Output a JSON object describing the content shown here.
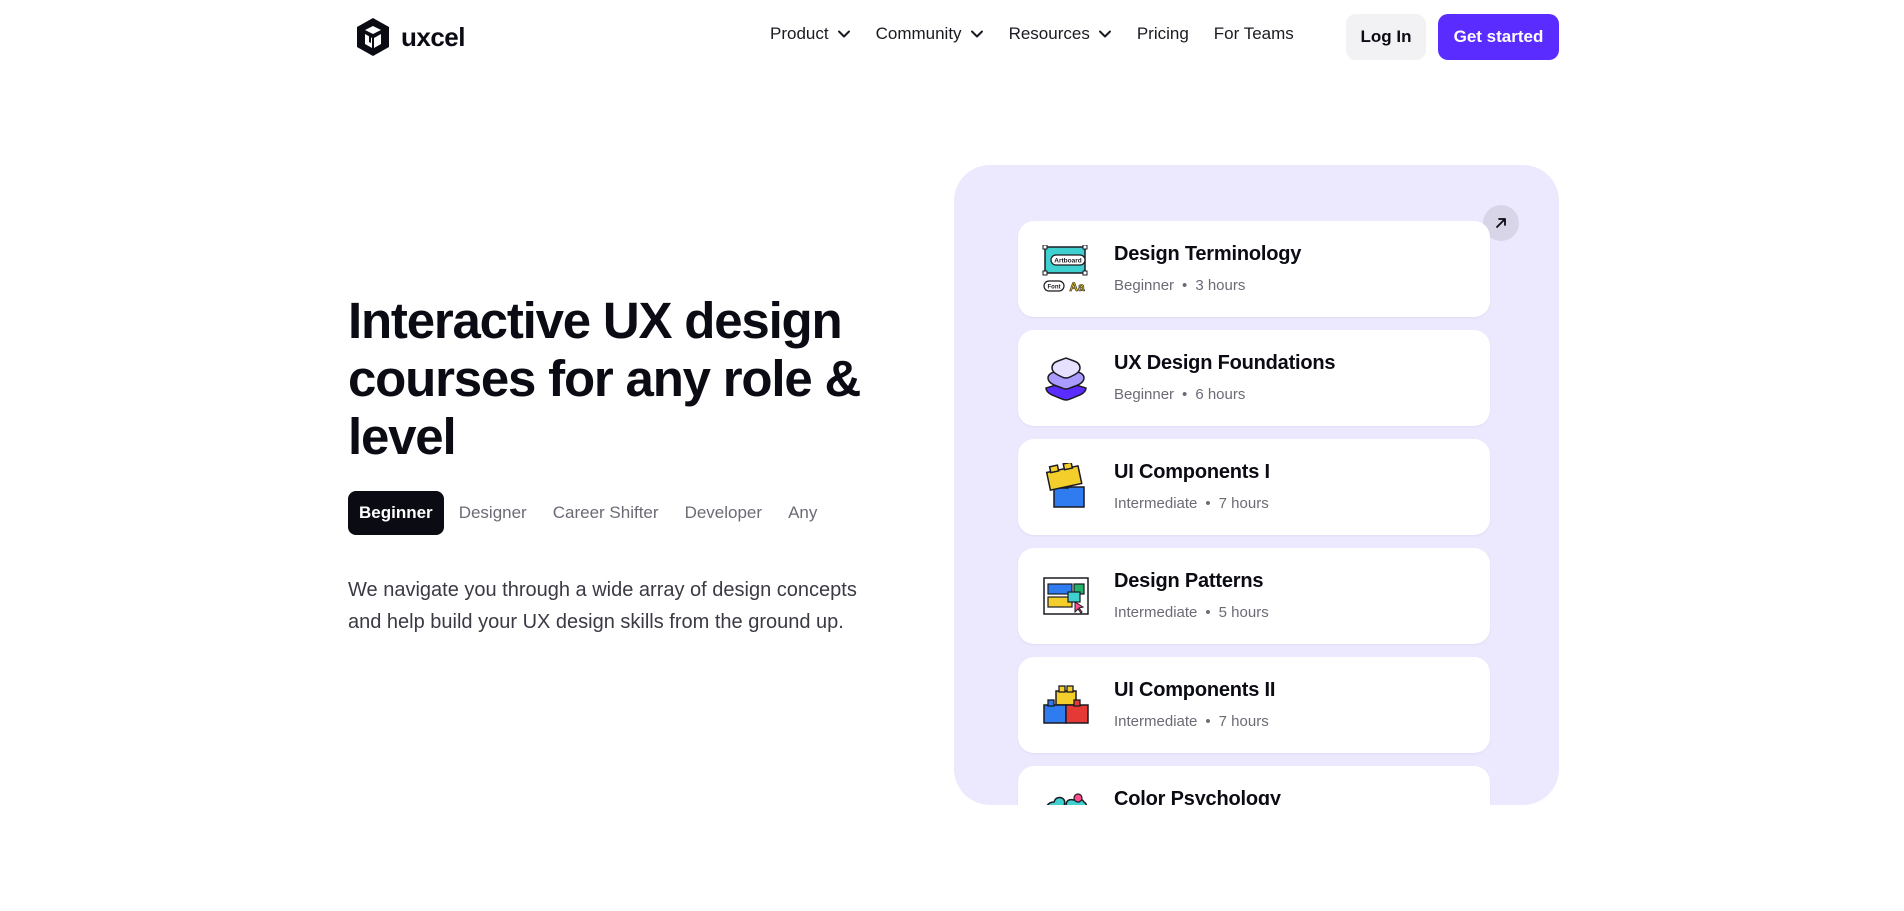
{
  "brand": {
    "name": "uxcel",
    "logo_icon": "uxcel-logo-icon"
  },
  "nav": {
    "items": [
      {
        "label": "Product",
        "dropdown": true
      },
      {
        "label": "Community",
        "dropdown": true
      },
      {
        "label": "Resources",
        "dropdown": true
      },
      {
        "label": "Pricing",
        "dropdown": false
      },
      {
        "label": "For Teams",
        "dropdown": false
      }
    ],
    "login_label": "Log In",
    "start_label": "Get started"
  },
  "hero": {
    "title": "Interactive UX design courses for any role & level",
    "roles": [
      "Beginner",
      "Designer",
      "Career Shifter",
      "Developer",
      "Any"
    ],
    "active_role": "Beginner",
    "description": "We navigate you through a wide array of design concepts and help build your UX design skills from the ground up."
  },
  "courses": [
    {
      "title": "Design Terminology",
      "level": "Beginner",
      "duration": "3 hours",
      "icon": "artboard-font-icon",
      "icon_text_top": "Artboard",
      "icon_text_left": "Font",
      "icon_text_right": "Aa"
    },
    {
      "title": "UX Design Foundations",
      "level": "Beginner",
      "duration": "6 hours",
      "icon": "layers-stack-icon"
    },
    {
      "title": "UI Components I",
      "level": "Intermediate",
      "duration": "7 hours",
      "icon": "building-blocks-icon"
    },
    {
      "title": "Design Patterns",
      "level": "Intermediate",
      "duration": "5 hours",
      "icon": "layout-patterns-icon"
    },
    {
      "title": "UI Components II",
      "level": "Intermediate",
      "duration": "7 hours",
      "icon": "blocks-row-icon"
    },
    {
      "title": "Color Psychology",
      "level": "",
      "duration": "",
      "icon": "color-clouds-icon"
    }
  ],
  "colors": {
    "accent": "#5b2cff",
    "panel_bg": "#ece8fe",
    "dark": "#0b0b14"
  }
}
